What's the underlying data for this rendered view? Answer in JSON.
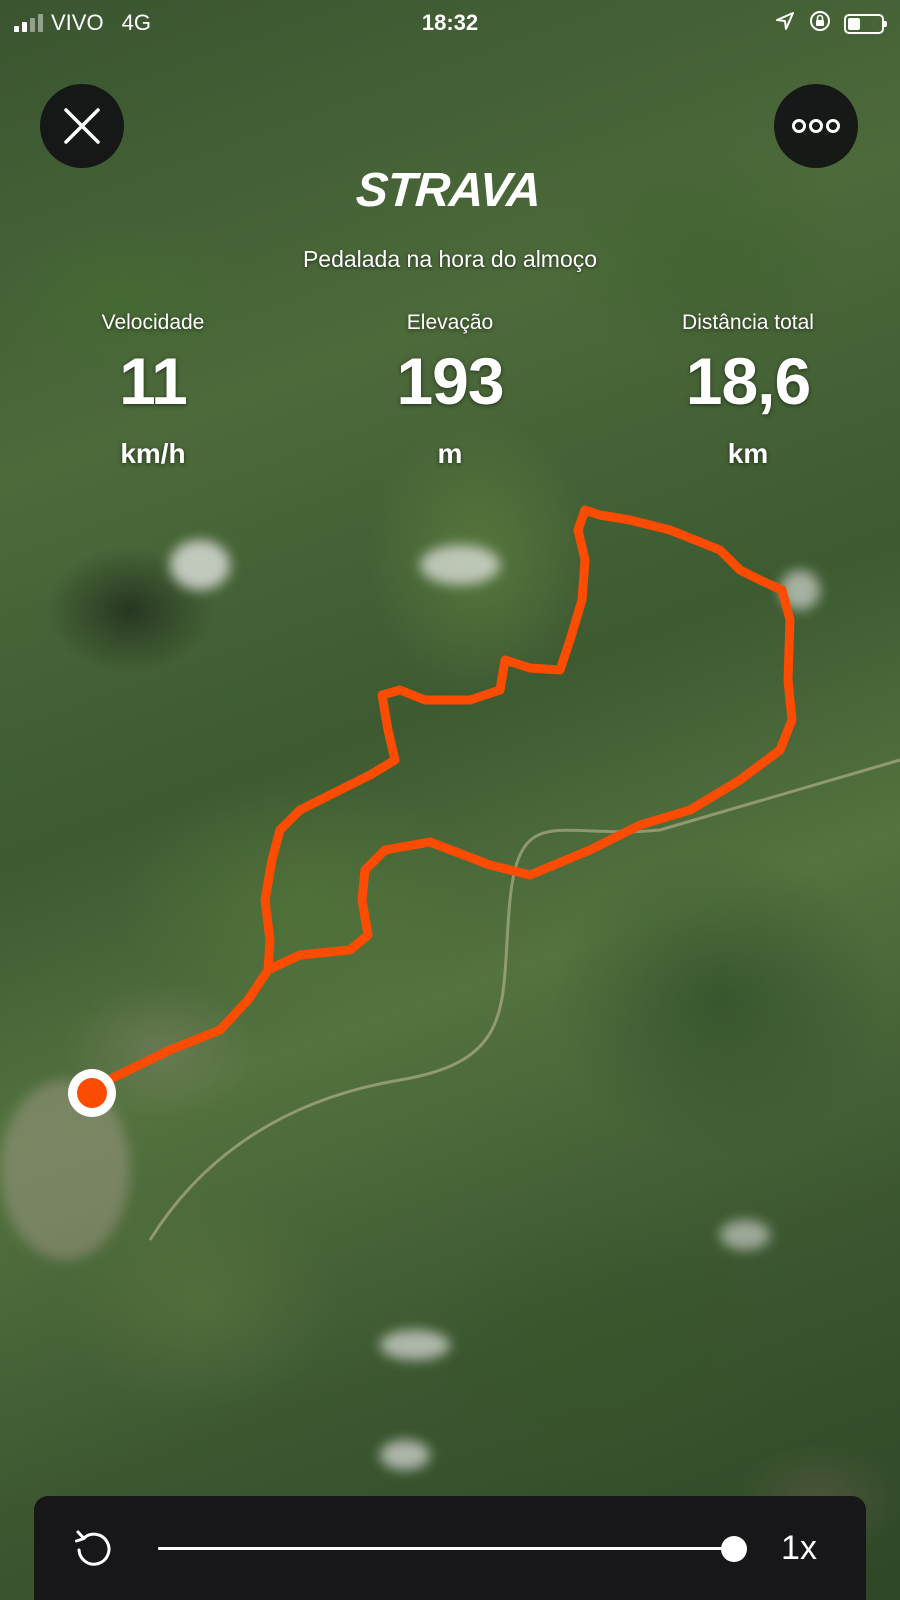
{
  "status_bar": {
    "carrier": "VIVO",
    "network": "4G",
    "time": "18:32"
  },
  "header": {
    "logo_text": "STRAVA",
    "activity_title": "Pedalada na hora do almoço"
  },
  "stats": {
    "speed": {
      "label": "Velocidade",
      "value": "11",
      "unit": "km/h"
    },
    "elevation": {
      "label": "Elevação",
      "value": "193",
      "unit": "m"
    },
    "distance": {
      "label": "Distância total",
      "value": "18,6",
      "unit": "km"
    }
  },
  "map": {
    "route_color": "#FC4C02",
    "start_marker_color": "#FC4C02"
  },
  "playback": {
    "speed_label": "1x",
    "progress": 1.0
  },
  "icons": {
    "close": "close-icon",
    "more": "more-dots-icon",
    "replay": "replay-icon",
    "location": "location-arrow-icon",
    "rotation_lock": "rotation-lock-icon",
    "battery": "battery-icon",
    "signal": "signal-bars-icon"
  }
}
